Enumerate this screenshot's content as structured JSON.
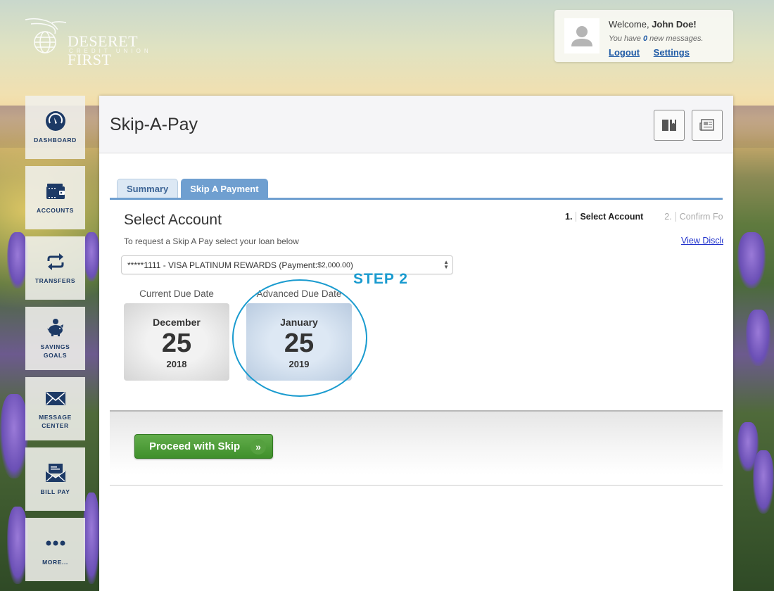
{
  "brand": {
    "name": "DESERET FIRST",
    "subtitle": "CREDIT UNION"
  },
  "user": {
    "welcome_prefix": "Welcome,",
    "name": "John Doe!",
    "msg_prefix": "You have",
    "msg_count": "0",
    "msg_suffix": "new messages.",
    "logout_label": "Logout",
    "settings_label": "Settings"
  },
  "sidebar": {
    "items": [
      {
        "label": "DASHBOARD",
        "icon": "gauge-icon"
      },
      {
        "label": "ACCOUNTS",
        "icon": "wallet-icon"
      },
      {
        "label": "TRANSFERS",
        "icon": "transfer-arrows-icon"
      },
      {
        "label": "SAVINGS GOALS",
        "icon": "piggy-bank-icon"
      },
      {
        "label": "MESSAGE CENTER",
        "icon": "envelope-icon"
      },
      {
        "label": "BILL PAY",
        "icon": "bill-envelope-icon"
      },
      {
        "label": "MORE...",
        "icon": "more-dots-icon"
      }
    ]
  },
  "page": {
    "title": "Skip-A-Pay",
    "header_buttons": [
      {
        "icon": "book-icon"
      },
      {
        "icon": "newspaper-icon"
      }
    ]
  },
  "tabs": [
    {
      "label": "Summary",
      "active": false
    },
    {
      "label": "Skip A Payment",
      "active": true
    }
  ],
  "form": {
    "section_title": "Select Account",
    "instruction": "To request a Skip A Pay select your loan below",
    "account_select_value": "*****1111 - VISA PLATINUM REWARDS (Payment:",
    "account_select_amount": "$2,000.00",
    "account_select_close": ")",
    "steps": [
      {
        "num": "1.",
        "label": "Select Account",
        "active": true
      },
      {
        "num": "2.",
        "label": "Confirm Form",
        "active": false
      }
    ],
    "view_disclosure_label": "View Disclosure",
    "current_due": {
      "label": "Current Due Date",
      "month": "December",
      "day": "25",
      "year": "2018"
    },
    "advanced_due": {
      "label": "Advanced Due Date",
      "month": "January",
      "day": "25",
      "year": "2019"
    },
    "annotation": "STEP 2",
    "proceed_label": "Proceed with Skip",
    "proceed_icon": "»"
  },
  "colors": {
    "accent_blue": "#6f9fd0",
    "annotation": "#1a9bcf",
    "proceed_green": "#4c9a37",
    "nav_text": "#1d3a66",
    "link": "#1f5aa6"
  }
}
